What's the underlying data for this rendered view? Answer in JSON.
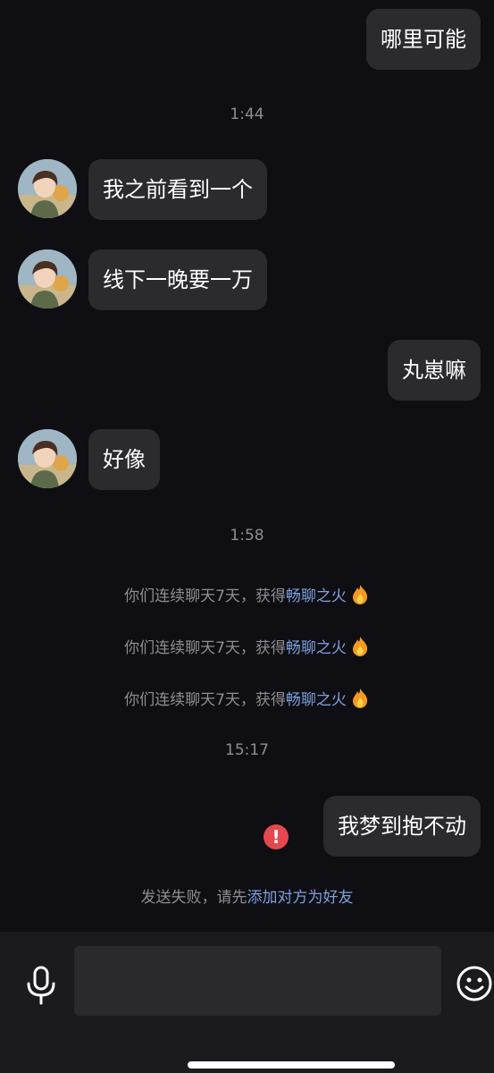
{
  "messages": {
    "m1": "哪里可能",
    "m2": "我之前看到一个",
    "m3": "线下一晚要一万",
    "m4": "丸崽嘛",
    "m5": "好像",
    "m6": "我梦到抱不动"
  },
  "timestamps": {
    "t1": "1:44",
    "t2": "1:58",
    "t3": "15:17"
  },
  "system_notices": [
    {
      "text": "你们连续聊天7天，获得",
      "highlight": "畅聊之火",
      "icon": "flame-icon"
    },
    {
      "text": "你们连续聊天7天，获得",
      "highlight": "畅聊之火",
      "icon": "flame-icon"
    },
    {
      "text": "你们连续聊天7天，获得",
      "highlight": "畅聊之火",
      "icon": "flame-icon"
    }
  ],
  "send_failure": {
    "text": "发送失败，请先",
    "link": "添加对方为好友"
  },
  "input_bar": {
    "value": "",
    "placeholder": "",
    "icons": [
      "microphone-icon",
      "emoji-icon"
    ]
  },
  "colors": {
    "background": "#0f0f13",
    "bubble": "#2b2b2e",
    "link": "#7e9fe0",
    "error": "#e5484d"
  }
}
